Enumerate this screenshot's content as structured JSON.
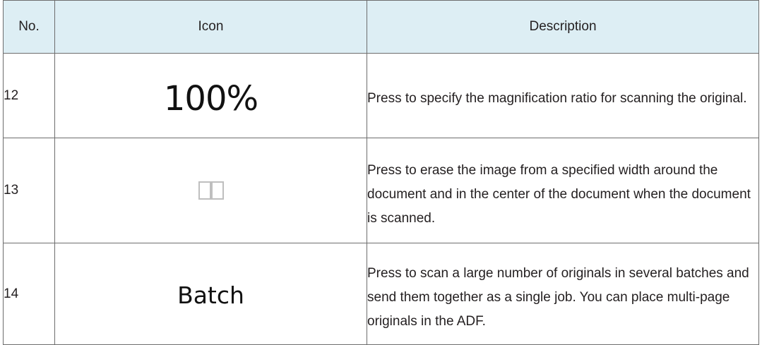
{
  "table": {
    "headers": {
      "no": "No.",
      "icon": "Icon",
      "description": "Description"
    },
    "rows": [
      {
        "no": "12",
        "icon_text": "100%",
        "icon_name": "magnification-ratio-icon",
        "description": "Press to specify the magnification ratio for scanning the original."
      },
      {
        "no": "13",
        "icon_text": "",
        "icon_name": "erase-border-center-icon",
        "description": "Press to erase the image from a specified width around the document and in the center of the document when the document is scanned."
      },
      {
        "no": "14",
        "icon_text": "Batch",
        "icon_name": "batch-icon",
        "description": "Press to scan a large number of originals in several batches and send them together as a single job. You can place multi-page originals in the ADF."
      }
    ]
  },
  "colors": {
    "header_background": "#ddeef4",
    "border": "#6d6d6d",
    "erase_icon_stroke": "#bfbfbf"
  }
}
